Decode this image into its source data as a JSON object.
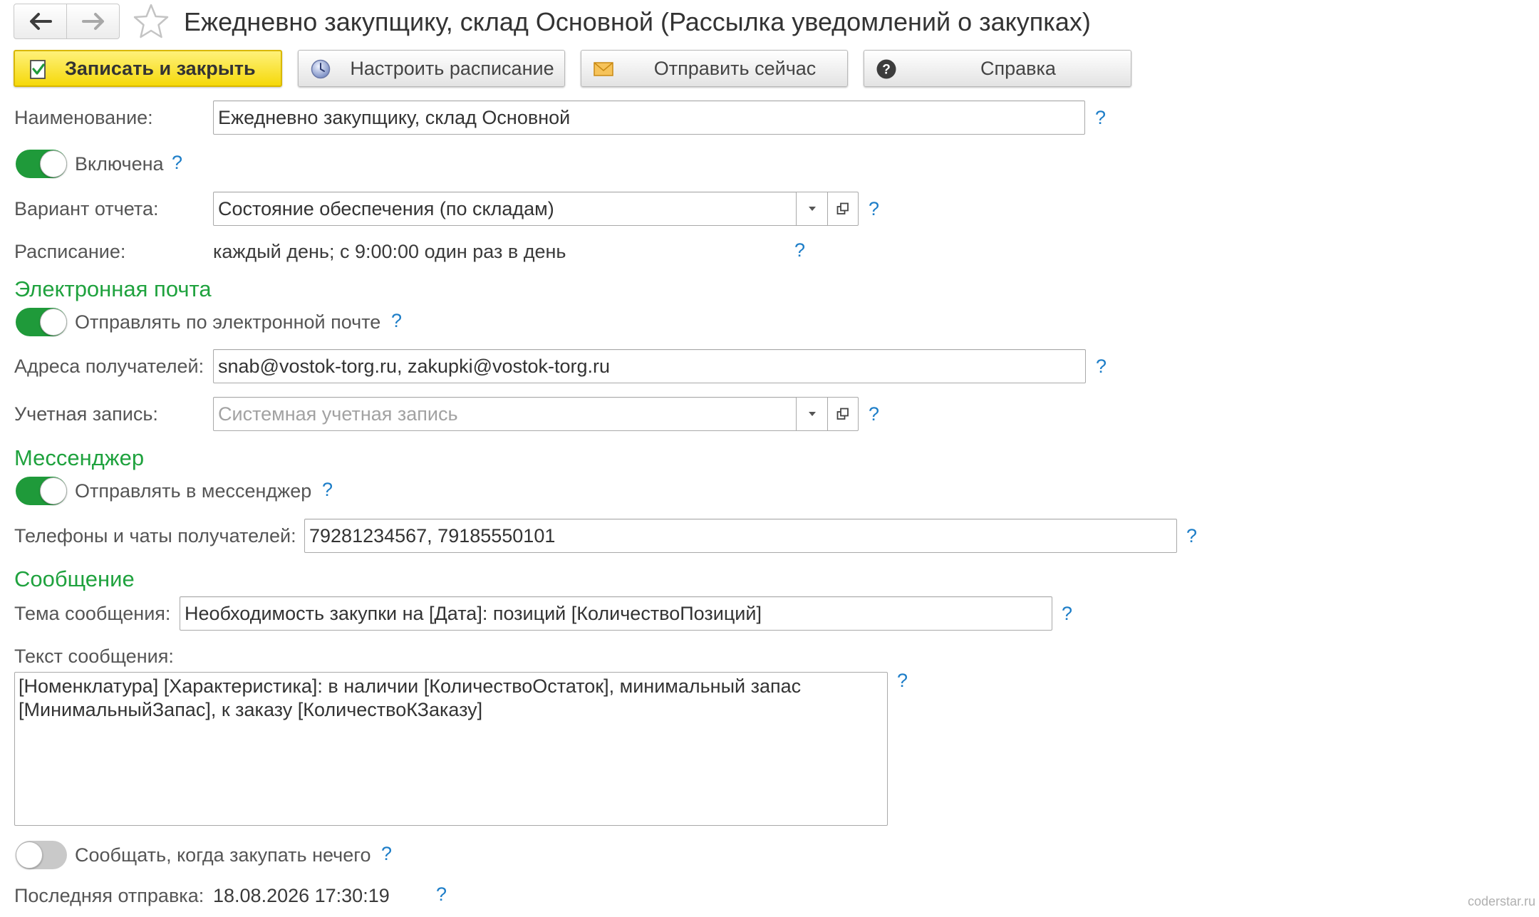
{
  "header": {
    "title": "Ежедневно закупщику, склад Основной (Рассылка уведомлений о закупках)"
  },
  "toolbar": {
    "save_close": "Записать и закрыть",
    "schedule": "Настроить расписание",
    "send_now": "Отправить сейчас",
    "help": "Справка"
  },
  "help_mark": "?",
  "form": {
    "name_label": "Наименование:",
    "name_value": "Ежедневно закупщику, склад Основной",
    "enabled_label": "Включена",
    "enabled": true,
    "report_variant_label": "Вариант отчета:",
    "report_variant_value": "Состояние обеспечения (по складам)",
    "schedule_label": "Расписание:",
    "schedule_value": "каждый день; с 9:00:00 один раз в день"
  },
  "email": {
    "section_title": "Электронная почта",
    "send_label": "Отправлять по электронной почте",
    "send_enabled": true,
    "recipients_label": "Адреса получателей:",
    "recipients_value": "snab@vostok-torg.ru, zakupki@vostok-torg.ru",
    "account_label": "Учетная запись:",
    "account_placeholder": "Системная учетная запись"
  },
  "messenger": {
    "section_title": "Мессенджер",
    "send_label": "Отправлять в мессенджер",
    "send_enabled": true,
    "phones_label": "Телефоны и чаты получателей:",
    "phones_value": "79281234567, 79185550101"
  },
  "message": {
    "section_title": "Сообщение",
    "subject_label": "Тема сообщения:",
    "subject_value": "Необходимость закупки на [Дата]: позиций [КоличествоПозиций]",
    "body_label": "Текст сообщения:",
    "body_value": "[Номенклатура] [Характеристика]: в наличии [КоличествоОстаток], минимальный запас\n[МинимальныйЗапас], к заказу [КоличествоКЗаказу]",
    "notify_nothing_label": "Сообщать, когда закупать нечего",
    "notify_nothing_enabled": false,
    "last_sent_label": "Последняя отправка:",
    "last_sent_value": "18.08.2026 17:30:19"
  },
  "watermark": "coderstar.ru",
  "colors": {
    "accent_green": "#1fa23e",
    "help_blue": "#1e7ec8",
    "primary_button": "#f5d90a"
  }
}
